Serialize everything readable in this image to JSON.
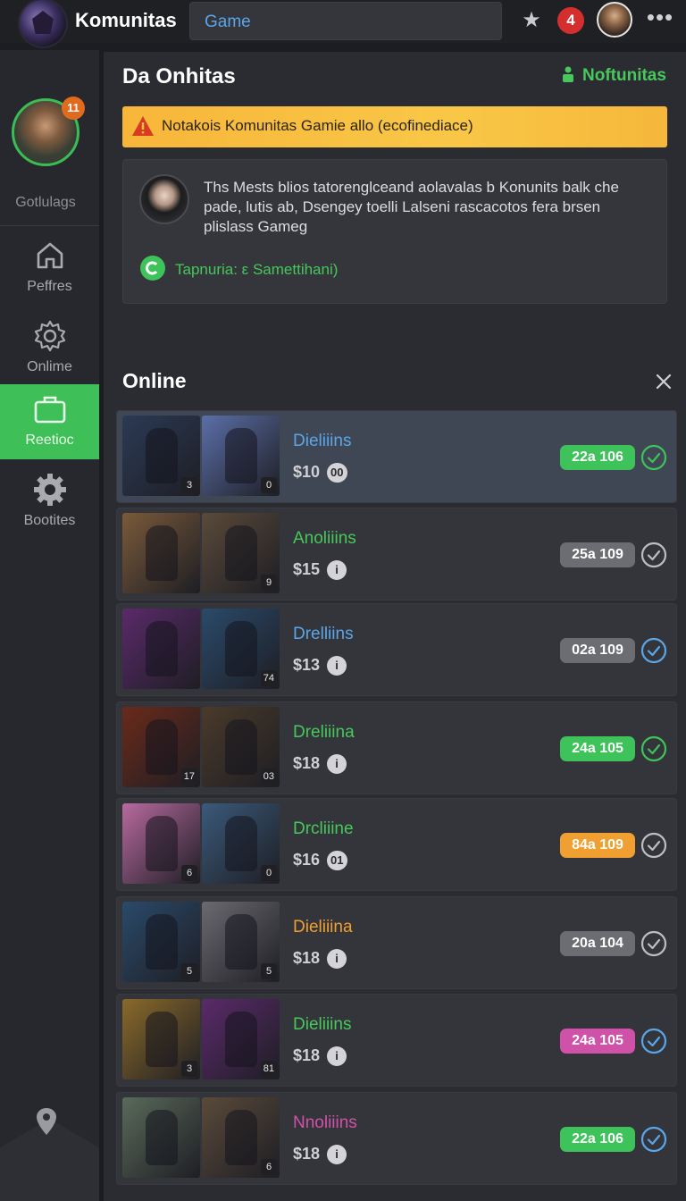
{
  "topbar": {
    "app_title": "Komunitas",
    "search_value": "Game",
    "notification_count": "4"
  },
  "sidebar": {
    "user_label": "Gotlulags",
    "avatar_badge": "11",
    "items": [
      {
        "label": "Peffres",
        "icon": "home-icon",
        "active": false
      },
      {
        "label": "Onlime",
        "icon": "settings-gear-icon",
        "active": false
      },
      {
        "label": "Reetioc",
        "icon": "briefcase-icon",
        "active": true
      },
      {
        "label": "Bootites",
        "icon": "gear-icon",
        "active": false
      }
    ]
  },
  "panel": {
    "title": "Da Onhitas",
    "link_label": "Noftunitas",
    "alert_text": "Notakois Komunitas Gamie allo (ecofinediace)",
    "post": {
      "text": "Ths Mests blios tatorenglceand aolavalas b Konunits balk che pade, lutis ab, Dsengey toelli Lalseni rascacotos fera brsen plislass Gameg",
      "reply_text": "Tapnuria: ε Samettihani)"
    }
  },
  "online": {
    "title": "Online",
    "rows": [
      {
        "name": "Dieliiins",
        "name_color": "#5aa6e8",
        "price": "$10",
        "info": "00",
        "pill": "22a 106",
        "pill_color": "#3ec25a",
        "check_color": "#3ec25a",
        "highlight": true,
        "badges": [
          "3",
          "0"
        ],
        "colors": [
          "#2b3a55",
          "#5b6fa8"
        ]
      },
      {
        "name": "Anoliiins",
        "name_color": "#46c85a",
        "price": "$15",
        "info": "i",
        "pill": "25a 109",
        "pill_color": "#6c6d73",
        "check_color": "#bdbec2",
        "highlight": false,
        "badges": [
          "",
          "9"
        ],
        "colors": [
          "#7a5a3a",
          "#5a4a3a"
        ]
      },
      {
        "name": "Drelliins",
        "name_color": "#5aa6e8",
        "price": "$13",
        "info": "i",
        "pill": "02a 109",
        "pill_color": "#6c6d73",
        "check_color": "#5aa6e8",
        "highlight": false,
        "badges": [
          "",
          "74"
        ],
        "colors": [
          "#5a2a6a",
          "#2a4a6a"
        ]
      },
      {
        "name": "Dreliiina",
        "name_color": "#46c85a",
        "price": "$18",
        "info": "i",
        "pill": "24a 105",
        "pill_color": "#3ec25a",
        "check_color": "#3ec25a",
        "highlight": false,
        "badges": [
          "17",
          "03"
        ],
        "colors": [
          "#6a2a1a",
          "#4a3a2a"
        ]
      },
      {
        "name": "Drcliiine",
        "name_color": "#46c85a",
        "price": "$16",
        "info": "01",
        "pill": "84a 109",
        "pill_color": "#f0a030",
        "check_color": "#bdbec2",
        "highlight": false,
        "badges": [
          "6",
          "0"
        ],
        "colors": [
          "#b86aa0",
          "#3a5a7a"
        ]
      },
      {
        "name": "Dieliiina",
        "name_color": "#f0a030",
        "price": "$18",
        "info": "i",
        "pill": "20a 104",
        "pill_color": "#6c6d73",
        "check_color": "#bdbec2",
        "highlight": false,
        "badges": [
          "5",
          "5"
        ],
        "colors": [
          "#2a4a6a",
          "#6a6a70"
        ]
      },
      {
        "name": "Dieliiins",
        "name_color": "#46c85a",
        "price": "$18",
        "info": "i",
        "pill": "24a 105",
        "pill_color": "#d052a8",
        "check_color": "#5aa6e8",
        "highlight": false,
        "badges": [
          "3",
          "81"
        ],
        "colors": [
          "#8a6a2a",
          "#5a2a6a"
        ]
      },
      {
        "name": "Nnoliiins",
        "name_color": "#d052a8",
        "price": "$18",
        "info": "i",
        "pill": "22a 106",
        "pill_color": "#3ec25a",
        "check_color": "#5aa6e8",
        "highlight": false,
        "badges": [
          "",
          "6"
        ],
        "colors": [
          "#5a6a5a",
          "#5a4a3a"
        ]
      }
    ]
  }
}
